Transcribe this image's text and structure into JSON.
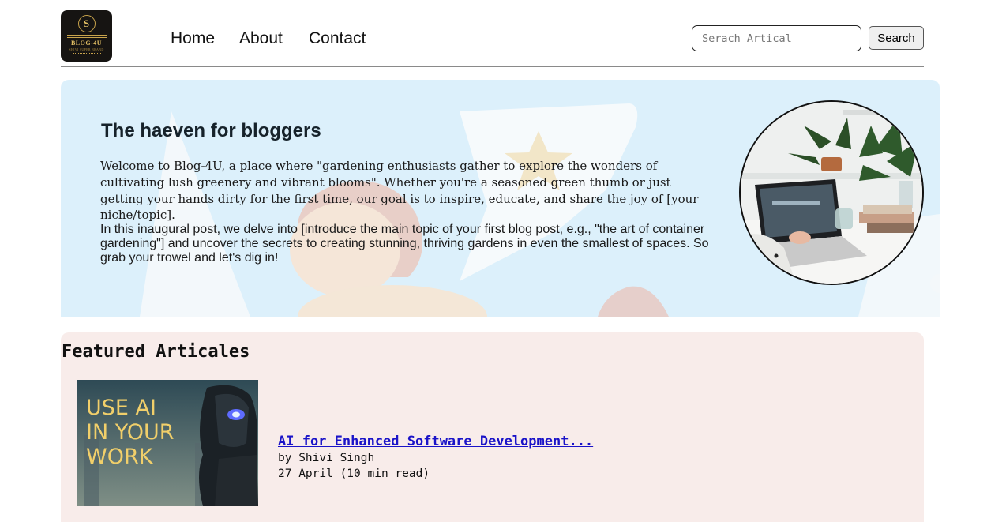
{
  "header": {
    "logo": {
      "icon": "blog-logo-icon",
      "monogram": "S",
      "brand": "BLOG-4U",
      "tagline": "SHIVI SUPER BRAND"
    },
    "nav": {
      "home": "Home",
      "about": "About",
      "contact": "Contact"
    },
    "search": {
      "placeholder": "Serach Artical",
      "value": "",
      "button_label": "Search"
    }
  },
  "hero": {
    "title": "The haeven for bloggers",
    "paragraph1": "Welcome to Blog-4U, a place where \"gardening enthusiasts gather to explore the wonders of cultivating lush greenery and vibrant blooms\". Whether you're a seasoned green thumb or just getting your hands dirty for the first time, our goal is to inspire, educate, and share the joy of [your niche/topic].",
    "paragraph2": "In this inaugural post, we delve into [introduce the main topic of your first blog post, e.g., \"the art of container gardening\"] and uncover the secrets to creating stunning, thriving gardens in even the smallest of spaces. So grab your trowel and let's dig in!",
    "image": "laptop-desk-plants-photo",
    "colors": {
      "background": "#dcf0fb"
    }
  },
  "featured": {
    "title": "Featured Articales",
    "colors": {
      "background": "#f8ecea",
      "link": "#1a13c8"
    },
    "articles": [
      {
        "thumbnail_lines": [
          "USE AI",
          "IN YOUR",
          "WORK"
        ],
        "thumbnail_icon": "robot-portrait-icon",
        "title": "AI for Enhanced Software Development...",
        "author_line": "by Shivi Singh",
        "date_line": "27 April (10 min read)"
      }
    ]
  }
}
